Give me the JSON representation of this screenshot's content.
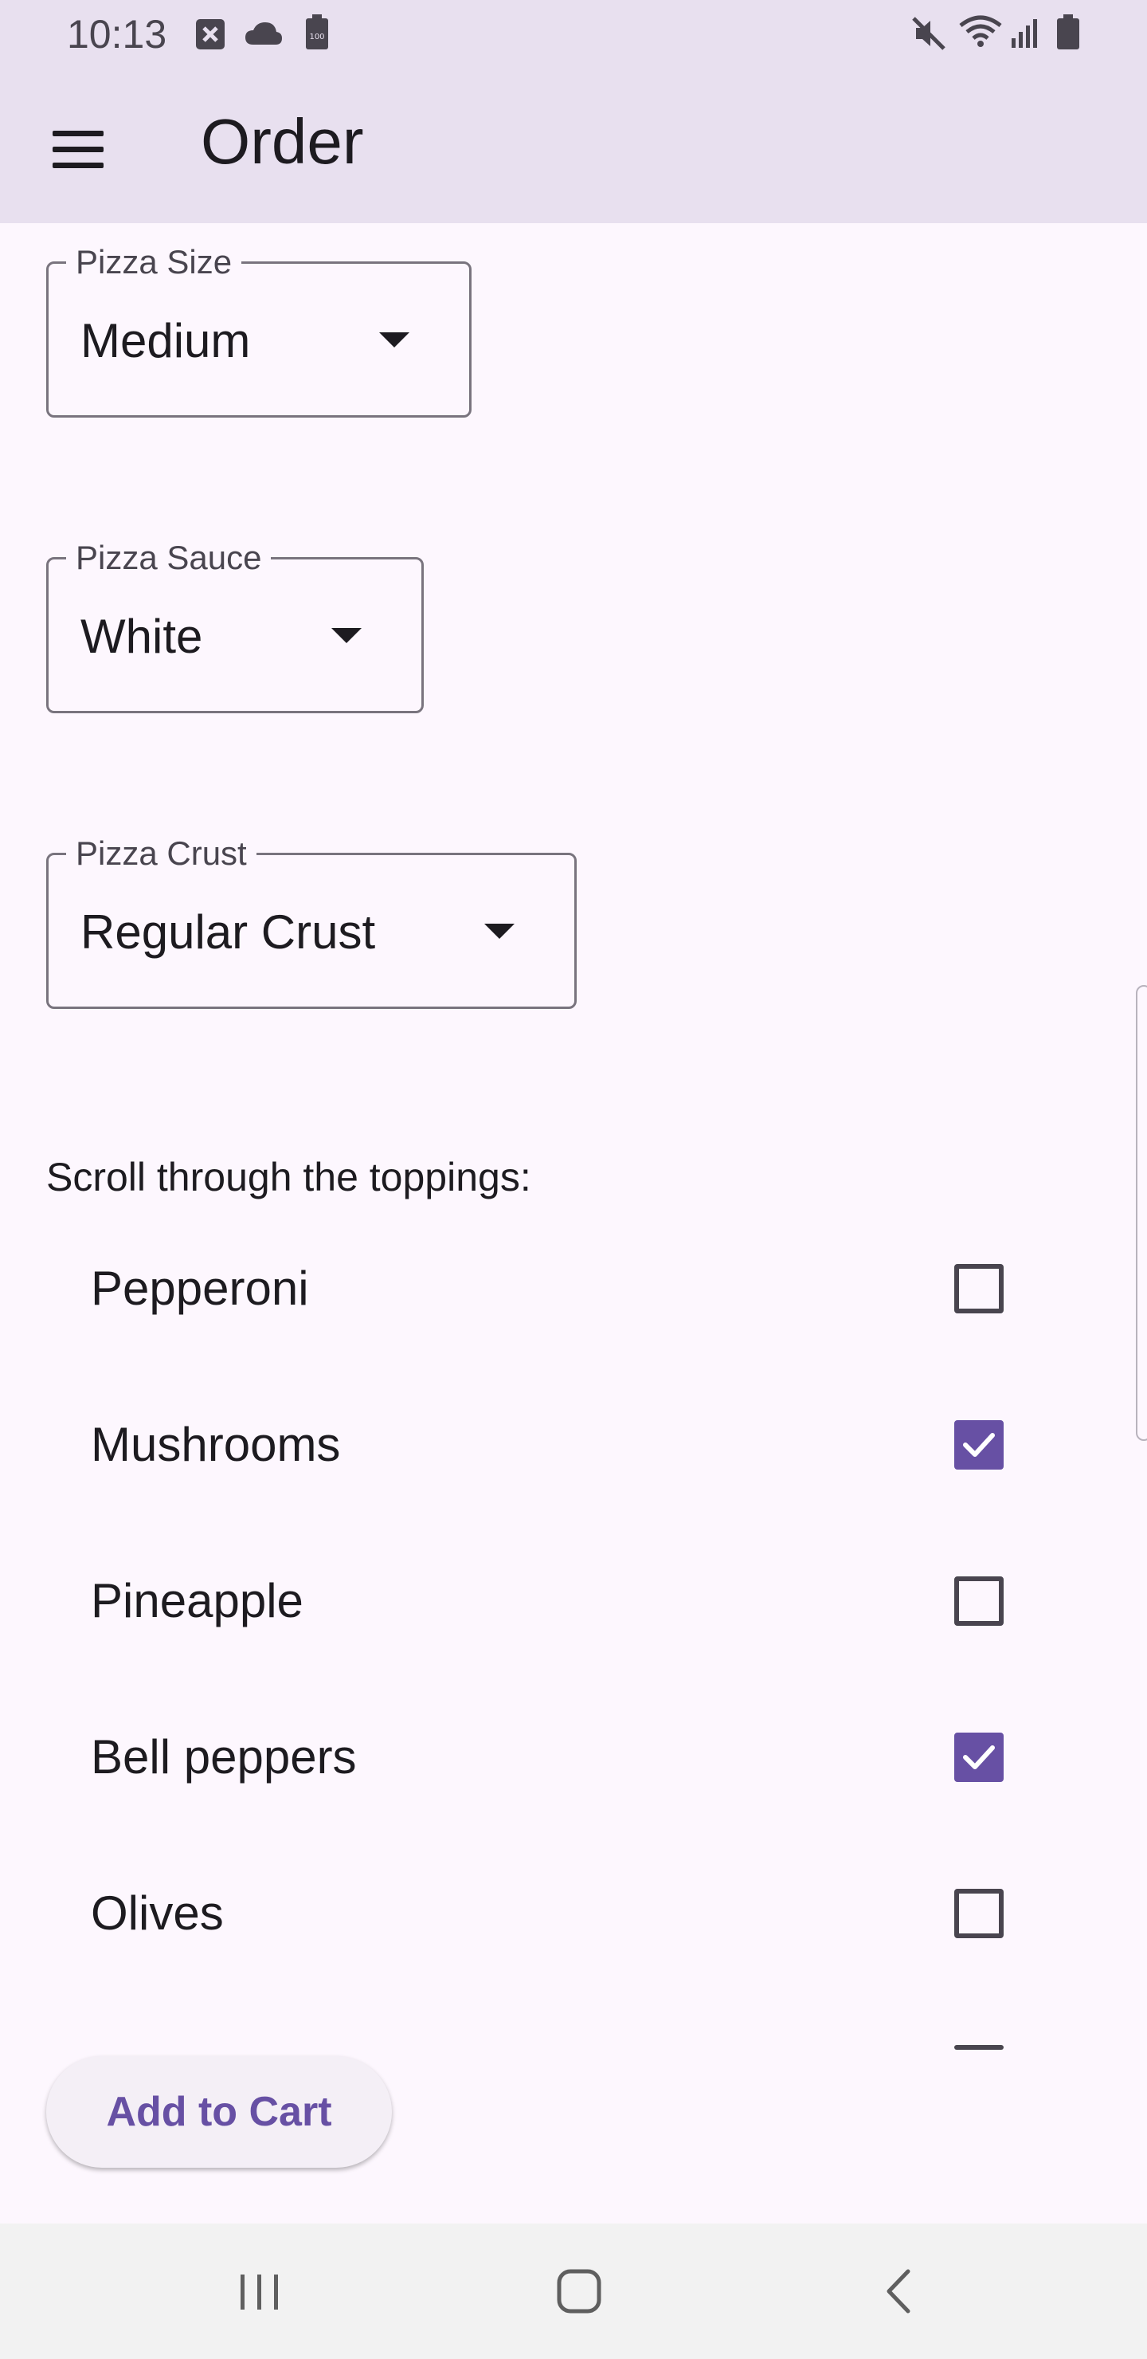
{
  "status_bar": {
    "time": "10:13",
    "icons_left": [
      "notification-x-icon",
      "cloud-icon",
      "battery-saver-icon"
    ],
    "icons_right": [
      "mute-icon",
      "wifi-icon",
      "signal-icon",
      "battery-icon"
    ]
  },
  "app_bar": {
    "title": "Order",
    "menu_icon": "hamburger-menu-icon"
  },
  "fields": {
    "size": {
      "label": "Pizza Size",
      "value": "Medium"
    },
    "sauce": {
      "label": "Pizza Sauce",
      "value": "White"
    },
    "crust": {
      "label": "Pizza Crust",
      "value": "Regular Crust"
    }
  },
  "toppings_prompt": "Scroll through the toppings:",
  "toppings": [
    {
      "label": "Pepperoni",
      "checked": false
    },
    {
      "label": "Mushrooms",
      "checked": true
    },
    {
      "label": "Pineapple",
      "checked": false
    },
    {
      "label": "Bell peppers",
      "checked": true
    },
    {
      "label": "Olives",
      "checked": false
    }
  ],
  "add_to_cart_label": "Add to Cart",
  "nav_bar": {
    "icons": [
      "recent-apps-icon",
      "home-icon",
      "back-icon"
    ]
  },
  "colors": {
    "primary": "#6750a4",
    "app_bar_bg": "#e8e0ef",
    "surface": "#fdf7fe"
  }
}
